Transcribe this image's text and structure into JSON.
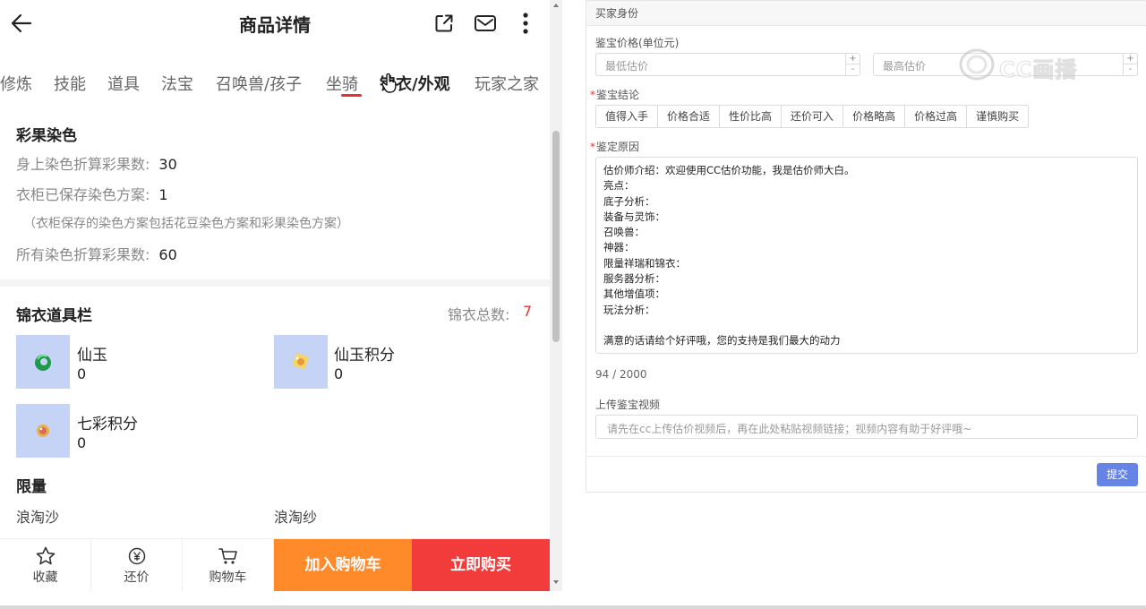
{
  "header": {
    "title": "商品详情"
  },
  "tabs": [
    "修炼",
    "技能",
    "道具",
    "法宝",
    "召唤兽/孩子",
    "坐骑",
    "锦衣/外观",
    "玩家之家"
  ],
  "dye": {
    "title": "彩果染色",
    "rows": [
      {
        "label": "身上染色折算彩果数:",
        "value": "30"
      },
      {
        "label": "衣柜已保存染色方案:",
        "value": "1"
      }
    ],
    "note": "（衣柜保存的染色方案包括花豆染色方案和彩果染色方案）",
    "total": {
      "label": "所有染色折算彩果数:",
      "value": "60"
    }
  },
  "wardrobe": {
    "title": "锦衣道具栏",
    "total_label": "锦衣总数:",
    "total_value": "7",
    "items": [
      {
        "name": "仙玉",
        "count": "0"
      },
      {
        "name": "仙玉积分",
        "count": "0"
      },
      {
        "name": "七彩积分",
        "count": "0"
      }
    ]
  },
  "limited": {
    "title": "限量",
    "items": [
      "浪淘沙",
      "浪淘纱"
    ]
  },
  "bottom": {
    "favorite": "收藏",
    "bargain": "还价",
    "cart": "购物车",
    "add_cart": "加入购物车",
    "buy_now": "立即购买"
  },
  "form": {
    "section_title": "买家身份",
    "price_label": "鉴宝价格(单位元)",
    "min_placeholder": "最低估价",
    "max_placeholder": "最高估价",
    "conclusion_label": "鉴宝结论",
    "conclusions": [
      "值得入手",
      "价格合适",
      "性价比高",
      "还价可入",
      "价格略高",
      "价格过高",
      "谨慎购买"
    ],
    "reason_label": "鉴定原因",
    "reason_lines": [
      "估价师介绍：欢迎使用CC估价功能，我是估价师大白。",
      "亮点：",
      "底子分析：",
      "装备与灵饰：",
      "召唤兽：",
      "神器：",
      "限量祥瑞和锦衣：",
      "服务器分析：",
      "其他增值项：",
      "玩法分析：",
      "",
      "满意的话请给个好评哦，您的支持是我们最大的动力"
    ],
    "counter": "94 / 2000",
    "video_label": "上传鉴宝视频",
    "video_placeholder": "请先在cc上传估价视频后，再在此处粘贴视频链接；视频内容有助于好评哦~",
    "submit": "提交"
  },
  "watermark": "CC画播"
}
